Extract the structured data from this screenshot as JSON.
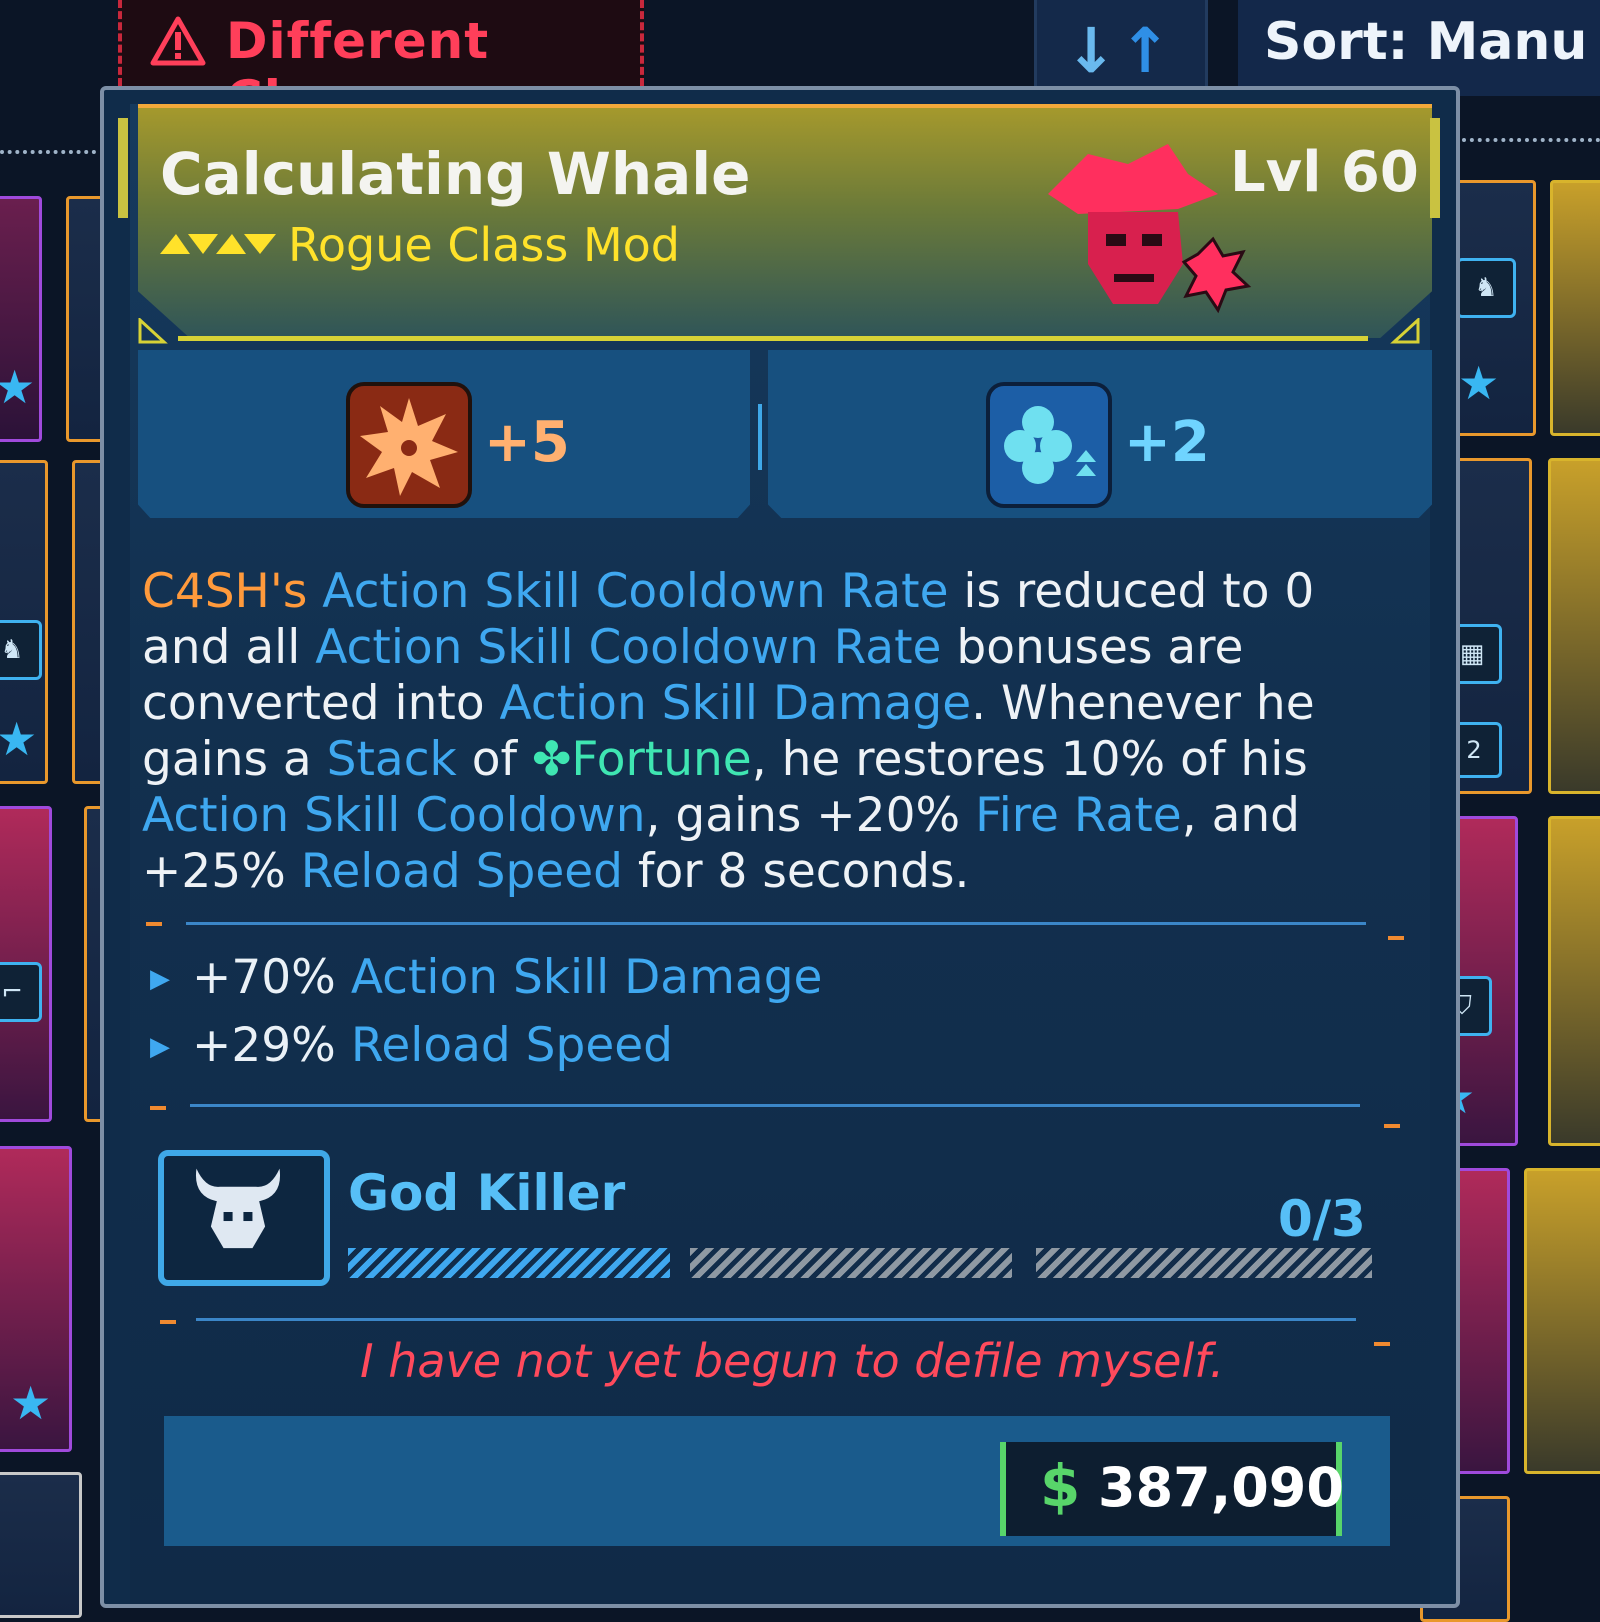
{
  "topbar": {
    "warning_label": "Different Class",
    "sort_label": "Sort: Manu"
  },
  "item": {
    "name": "Calculating Whale",
    "type": "Rogue Class Mod",
    "level": "Lvl 60",
    "rarity_color": "#ffe22a"
  },
  "skills": [
    {
      "icon": "fire-burst-skill-icon",
      "value": "+5",
      "color": "#ff9a3c"
    },
    {
      "icon": "fortune-clover-skill-icon",
      "value": "+2",
      "color": "#3fa8f0"
    }
  ],
  "description": {
    "p1": "C4SH's",
    "p2": "Action Skill Cooldown Rate",
    "p3": " is reduced to 0 and all ",
    "p4": "Action Skill Cooldown Rate",
    "p5": " bonuses are converted into ",
    "p6": "Action Skill Damage",
    "p7": ". Whenever he gains a ",
    "p8": "Stack",
    "p9": " of ",
    "p10": "Fortune",
    "p11": ", he restores 10% of his ",
    "p12": "Action Skill Cooldown",
    "p13": ", gains +20% ",
    "p14": "Fire Rate",
    "p15": ", and +25% ",
    "p16": "Reload Speed",
    "p17": " for 8 seconds."
  },
  "stats": [
    {
      "value": "+70%",
      "name": "Action Skill Damage"
    },
    {
      "value": "+29%",
      "name": "Reload Speed"
    }
  ],
  "challenge": {
    "name": "God Killer",
    "progress": "0/3",
    "icon": "horned-skull-icon",
    "completed": 0,
    "total": 3
  },
  "flavor_text": "I have not yet begun to defile myself.",
  "price": {
    "symbol": "$",
    "value": "387,090"
  },
  "colors": {
    "accent_blue": "#3fa8f0",
    "accent_orange": "#ff9a3c",
    "warning_red": "#ff3f5a",
    "money_green": "#58d56a"
  }
}
